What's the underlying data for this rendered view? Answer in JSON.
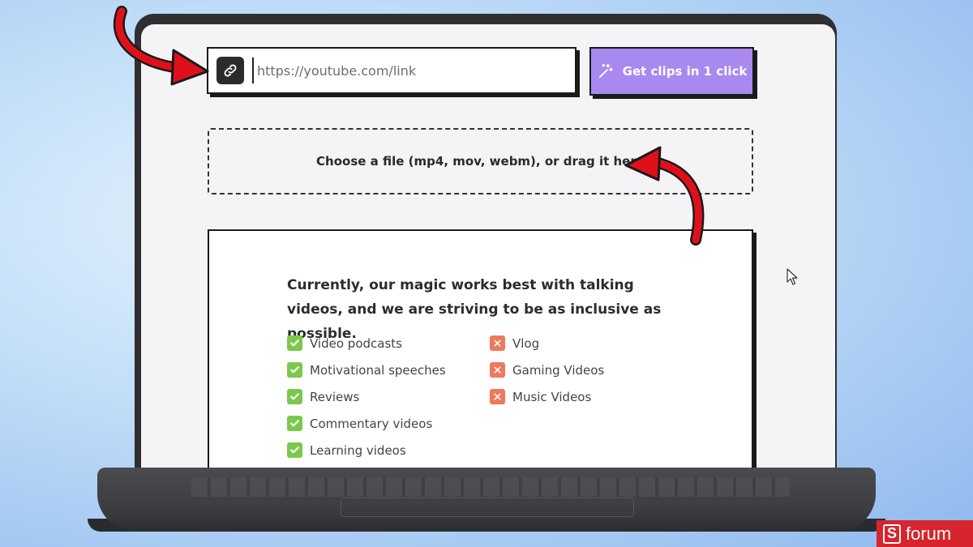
{
  "url_field": {
    "placeholder": "https://youtube.com/link"
  },
  "actions": {
    "get_clips_label": "Get clips in 1 click"
  },
  "dropzone": {
    "label": "Choose a file (mp4, mov, webm), or drag it here"
  },
  "info": {
    "heading": "Currently, our magic works best with talking videos, and we are striving to be as inclusive as possible.",
    "supported": [
      "Video podcasts",
      "Motivational speeches",
      "Reviews",
      "Commentary videos",
      "Learning videos"
    ],
    "unsupported": [
      "Vlog",
      "Gaming Videos",
      "Music Videos"
    ]
  },
  "watermark": {
    "text": "forum",
    "logo_letter": "S"
  },
  "colors": {
    "accent": "#a988f0",
    "check": "#7cc84d",
    "cross": "#ee7a5c",
    "annotation_arrow": "#e0101a",
    "brand": "#d8242c"
  },
  "icons": {
    "url_field": "link-icon",
    "get_clips": "magic-wand-icon",
    "supported": "check-icon",
    "unsupported": "x-icon"
  }
}
